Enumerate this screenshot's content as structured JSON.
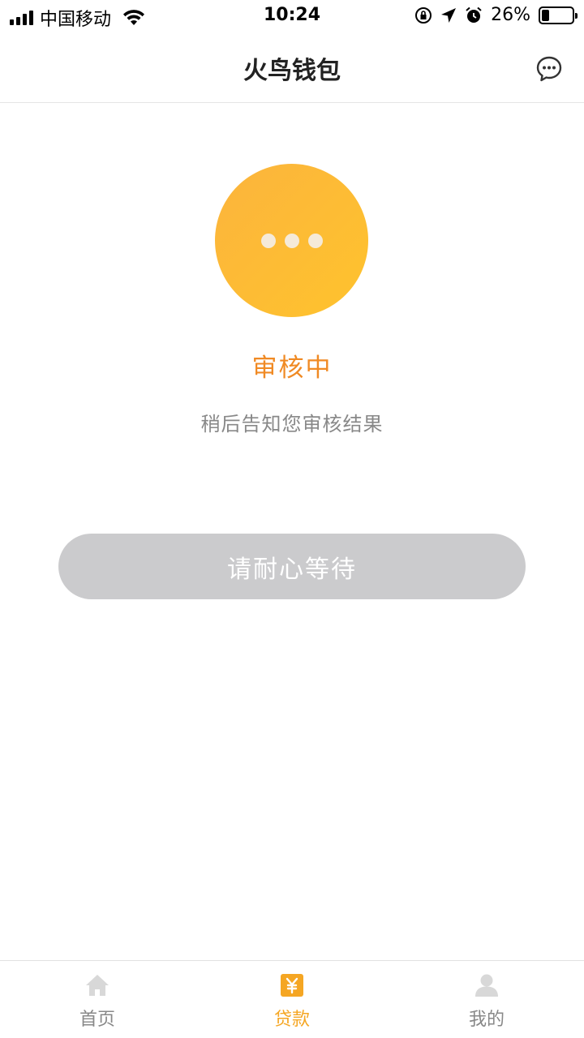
{
  "status_bar": {
    "carrier": "中国移动",
    "time": "10:24",
    "battery": "26%",
    "battery_level": 0.26
  },
  "nav": {
    "title": "火鸟钱包",
    "message_icon": "chat-bubble-icon"
  },
  "review": {
    "icon": "more-dots-icon",
    "title": "审核中",
    "subtitle": "稍后告知您审核结果",
    "button_label": "请耐心等待"
  },
  "tabs": [
    {
      "label": "首页",
      "icon": "home-icon",
      "active": false
    },
    {
      "label": "贷款",
      "icon": "yuan-icon",
      "active": true
    },
    {
      "label": "我的",
      "icon": "user-icon",
      "active": false
    }
  ],
  "colors": {
    "accent": "#f5a623",
    "status_text": "#f08a24",
    "circle": "#fdbb35",
    "button_disabled": "#cbcbcd"
  }
}
